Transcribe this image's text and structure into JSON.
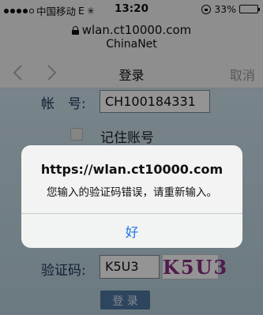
{
  "status_bar": {
    "carrier": "中国移动",
    "network": "E",
    "time": "13:20",
    "battery": "33%",
    "battery_level": 0.33
  },
  "address_bar": {
    "url": "wlan.ct10000.com",
    "site_name": "ChinaNet"
  },
  "navbar": {
    "back_icon": "chevron-left-icon",
    "forward_icon": "chevron-right-icon",
    "title": "登录",
    "cancel": "取消"
  },
  "form": {
    "account_label": "帐　号:",
    "account_value": "CH100184331",
    "remember_label": "记住账号",
    "captcha_label": "验证码:",
    "captcha_value": "K5U3",
    "captcha_image_text": "K5U3",
    "login_button": "登 录"
  },
  "alert": {
    "title": "https://wlan.ct10000.com",
    "message": "您输入的验证码错误，请重新输入。",
    "ok_button": "好"
  },
  "colors": {
    "link_blue": "#1a74e8",
    "label_navy": "#1e3560"
  }
}
